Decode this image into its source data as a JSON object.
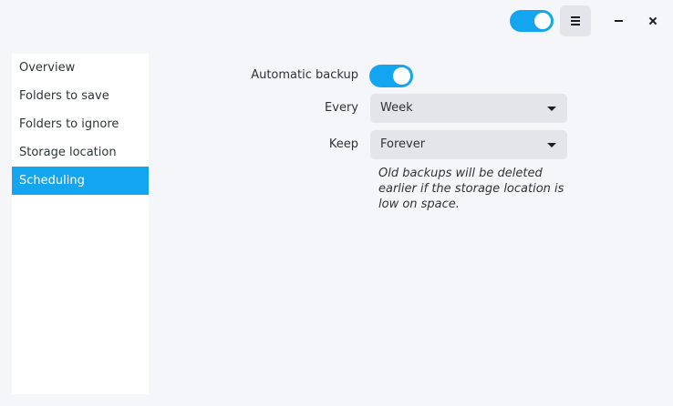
{
  "header": {
    "toggle": {
      "state": "on"
    },
    "menu_icon": "hamburger-menu-icon",
    "minimize_icon": "minimize-icon",
    "close_icon": "close-icon"
  },
  "sidebar": {
    "items": [
      {
        "label": "Overview",
        "active": false
      },
      {
        "label": "Folders to save",
        "active": false
      },
      {
        "label": "Folders to ignore",
        "active": false
      },
      {
        "label": "Storage location",
        "active": false
      },
      {
        "label": "Scheduling",
        "active": true
      }
    ]
  },
  "scheduling": {
    "automatic_backup_label": "Automatic backup",
    "automatic_backup_state": "on",
    "every_label": "Every",
    "every_value": "Week",
    "keep_label": "Keep",
    "keep_value": "Forever",
    "note": "Old backups will be deleted earlier if the storage location is low on space."
  },
  "colors": {
    "accent": "#13a5f0",
    "window_bg": "#f5f6fa",
    "sidebar_bg": "#ffffff",
    "combo_bg": "#e3e5ea"
  }
}
